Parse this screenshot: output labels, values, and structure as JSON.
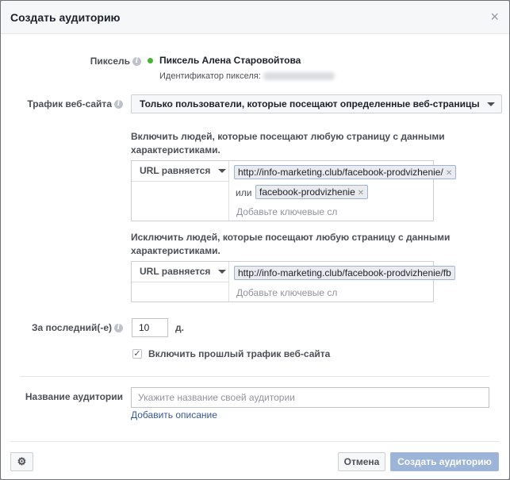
{
  "dialog": {
    "title": "Создать аудиторию",
    "close_label": "×"
  },
  "pixel": {
    "label": "Пиксель",
    "name": "Пиксель Алена Старовойтова",
    "id_label": "Идентификатор пикселя:",
    "status_color": "#42b72a"
  },
  "traffic": {
    "label": "Трафик веб-сайта",
    "selected": "Только пользователи, которые посещают определенные веб-страницы"
  },
  "include": {
    "heading_line1": "Включить людей, которые посещают любую страницу с данными",
    "heading_line2": "характеристиками.",
    "condition": "URL равняется",
    "tokens": [
      "http://info-marketing.club/facebook-prodvizhenie/",
      "facebook-prodvizhenie"
    ],
    "or_label": "или",
    "placeholder": "Добавьте ключевые сл"
  },
  "exclude": {
    "heading_line1": "Исключить людей, которые посещают любую страницу с данными",
    "heading_line2": "характеристиками.",
    "condition": "URL равняется",
    "token": "http://info-marketing.club/facebook-prodvizhenie/fb",
    "placeholder": "Добавьте ключевые сл"
  },
  "retention": {
    "label": "За последний(-е)",
    "value": "10",
    "unit": "д."
  },
  "past_traffic": {
    "label": "Включить прошлый трафик веб-сайта",
    "checked": true
  },
  "audience_name": {
    "label": "Название аудитории",
    "placeholder": "Укажите название своей аудитории",
    "add_description": "Добавить описание"
  },
  "footer": {
    "cancel": "Отмена",
    "create": "Создать аудиторию"
  },
  "colors": {
    "primary_button": "#9cb4d8",
    "link": "#365899"
  }
}
